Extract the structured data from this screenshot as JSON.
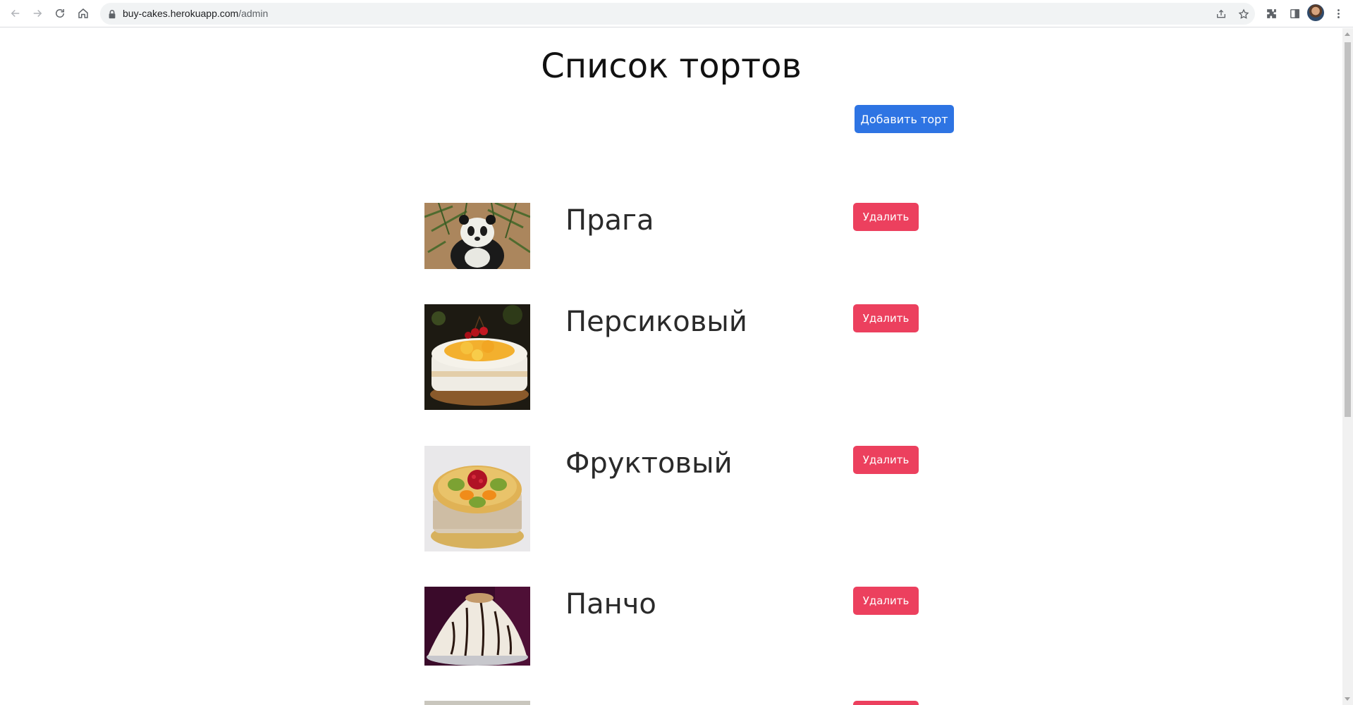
{
  "browser": {
    "url_host": "buy-cakes.herokuapp.com",
    "url_path": "/admin",
    "icons": [
      "back-icon",
      "forward-icon",
      "reload-icon",
      "home-icon",
      "lock-icon",
      "share-icon",
      "star-icon",
      "extensions-icon",
      "side-panel-icon",
      "profile-avatar",
      "menu-icon"
    ]
  },
  "page": {
    "title": "Список тортов",
    "add_button_label": "Добавить торт",
    "delete_label": "Удалить"
  },
  "cakes": [
    {
      "name": "Прага",
      "image": "panda-photo"
    },
    {
      "name": "Персиковый",
      "image": "peach-cake-photo"
    },
    {
      "name": "Фруктовый",
      "image": "fruit-cake-photo"
    },
    {
      "name": "Панчо",
      "image": "pancho-cake-photo"
    }
  ],
  "colors": {
    "primary": "#2e74e3",
    "danger": "#ec405e"
  }
}
